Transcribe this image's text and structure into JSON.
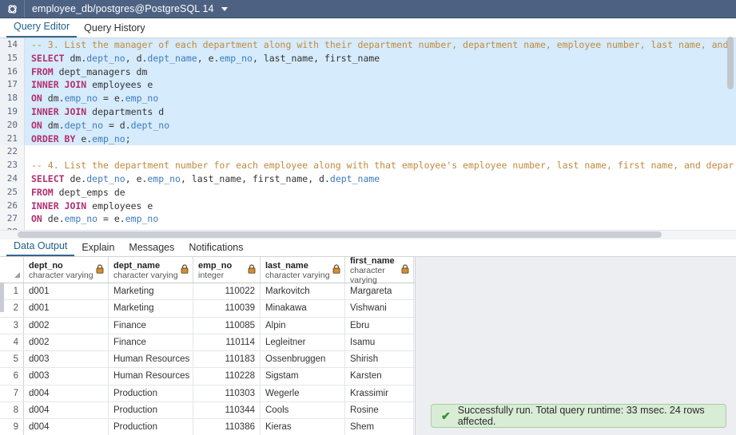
{
  "titlebar": {
    "connection": "employee_db/postgres@PostgreSQL 14",
    "icon": "query-tool-icon",
    "dropdown_icon": "chevron-down-icon"
  },
  "tabs": [
    {
      "label": "Query Editor",
      "active": true
    },
    {
      "label": "Query History",
      "active": false
    }
  ],
  "editor": {
    "lines": [
      {
        "no": "14",
        "selected": true,
        "tokens": [
          {
            "t": "cm",
            "v": "-- 3. List the manager of each department along with their department number, department name, employee number, last name, and"
          }
        ]
      },
      {
        "no": "15",
        "selected": true,
        "tokens": [
          {
            "t": "kw",
            "v": "SELECT"
          },
          {
            "t": "pl",
            "v": " dm."
          },
          {
            "t": "id",
            "v": "dept_no"
          },
          {
            "t": "pl",
            "v": ", d."
          },
          {
            "t": "id",
            "v": "dept_name"
          },
          {
            "t": "pl",
            "v": ", e."
          },
          {
            "t": "id",
            "v": "emp_no"
          },
          {
            "t": "pl",
            "v": ", last_name, first_name"
          }
        ]
      },
      {
        "no": "16",
        "selected": true,
        "tokens": [
          {
            "t": "kw",
            "v": "FROM"
          },
          {
            "t": "pl",
            "v": " dept_managers dm"
          }
        ]
      },
      {
        "no": "17",
        "selected": true,
        "tokens": [
          {
            "t": "kw",
            "v": "INNER JOIN"
          },
          {
            "t": "pl",
            "v": " employees e"
          }
        ]
      },
      {
        "no": "18",
        "selected": true,
        "tokens": [
          {
            "t": "kw",
            "v": "ON"
          },
          {
            "t": "pl",
            "v": " dm."
          },
          {
            "t": "id",
            "v": "emp_no"
          },
          {
            "t": "pl",
            "v": " = e."
          },
          {
            "t": "id",
            "v": "emp_no"
          }
        ]
      },
      {
        "no": "19",
        "selected": true,
        "tokens": [
          {
            "t": "kw",
            "v": "INNER JOIN"
          },
          {
            "t": "pl",
            "v": " departments d"
          }
        ]
      },
      {
        "no": "20",
        "selected": true,
        "tokens": [
          {
            "t": "kw",
            "v": "ON"
          },
          {
            "t": "pl",
            "v": " dm."
          },
          {
            "t": "id",
            "v": "dept_no"
          },
          {
            "t": "pl",
            "v": " = d."
          },
          {
            "t": "id",
            "v": "dept_no"
          }
        ]
      },
      {
        "no": "21",
        "selected": true,
        "tokens": [
          {
            "t": "kw",
            "v": "ORDER BY"
          },
          {
            "t": "pl",
            "v": " e."
          },
          {
            "t": "id",
            "v": "emp_no"
          },
          {
            "t": "pl",
            "v": ";"
          }
        ]
      },
      {
        "no": "22",
        "selected": false,
        "tokens": [
          {
            "t": "pl",
            "v": ""
          }
        ]
      },
      {
        "no": "23",
        "selected": false,
        "tokens": [
          {
            "t": "cm",
            "v": "-- 4. List the department number for each employee along with that employee's employee number, last name, first name, and depar"
          }
        ]
      },
      {
        "no": "24",
        "selected": false,
        "tokens": [
          {
            "t": "kw",
            "v": "SELECT"
          },
          {
            "t": "pl",
            "v": " de."
          },
          {
            "t": "id",
            "v": "dept_no"
          },
          {
            "t": "pl",
            "v": ", e."
          },
          {
            "t": "id",
            "v": "emp_no"
          },
          {
            "t": "pl",
            "v": ", last_name, first_name, d."
          },
          {
            "t": "id",
            "v": "dept_name"
          }
        ]
      },
      {
        "no": "25",
        "selected": false,
        "tokens": [
          {
            "t": "kw",
            "v": "FROM"
          },
          {
            "t": "pl",
            "v": " dept_emps de"
          }
        ]
      },
      {
        "no": "26",
        "selected": false,
        "tokens": [
          {
            "t": "kw",
            "v": "INNER JOIN"
          },
          {
            "t": "pl",
            "v": " employees e"
          }
        ]
      },
      {
        "no": "27",
        "selected": false,
        "tokens": [
          {
            "t": "kw",
            "v": "ON"
          },
          {
            "t": "pl",
            "v": " de."
          },
          {
            "t": "id",
            "v": "emp_no"
          },
          {
            "t": "pl",
            "v": " = e."
          },
          {
            "t": "id",
            "v": "emp_no"
          }
        ]
      },
      {
        "no": "28",
        "selected": false,
        "tokens": [
          {
            "t": "pl",
            "v": ""
          }
        ]
      }
    ]
  },
  "output": {
    "tabs": [
      {
        "label": "Data Output",
        "active": true
      },
      {
        "label": "Explain",
        "active": false
      },
      {
        "label": "Messages",
        "active": false
      },
      {
        "label": "Notifications",
        "active": false
      }
    ],
    "columns": [
      {
        "name": "dept_no",
        "type": "character varying",
        "lock": "lock-icon"
      },
      {
        "name": "dept_name",
        "type": "character varying",
        "lock": "lock-icon"
      },
      {
        "name": "emp_no",
        "type": "integer",
        "lock": "lock-icon"
      },
      {
        "name": "last_name",
        "type": "character varying",
        "lock": "lock-icon"
      },
      {
        "name": "first_name",
        "type": "character varying",
        "lock": "lock-icon"
      }
    ],
    "rows": [
      {
        "n": "1",
        "dept_no": "d001",
        "dept_name": "Marketing",
        "emp_no": "110022",
        "last_name": "Markovitch",
        "first_name": "Margareta"
      },
      {
        "n": "2",
        "dept_no": "d001",
        "dept_name": "Marketing",
        "emp_no": "110039",
        "last_name": "Minakawa",
        "first_name": "Vishwani"
      },
      {
        "n": "3",
        "dept_no": "d002",
        "dept_name": "Finance",
        "emp_no": "110085",
        "last_name": "Alpin",
        "first_name": "Ebru"
      },
      {
        "n": "4",
        "dept_no": "d002",
        "dept_name": "Finance",
        "emp_no": "110114",
        "last_name": "Legleitner",
        "first_name": "Isamu"
      },
      {
        "n": "5",
        "dept_no": "d003",
        "dept_name": "Human Resources",
        "emp_no": "110183",
        "last_name": "Ossenbruggen",
        "first_name": "Shirish"
      },
      {
        "n": "6",
        "dept_no": "d003",
        "dept_name": "Human Resources",
        "emp_no": "110228",
        "last_name": "Sigstam",
        "first_name": "Karsten"
      },
      {
        "n": "7",
        "dept_no": "d004",
        "dept_name": "Production",
        "emp_no": "110303",
        "last_name": "Wegerle",
        "first_name": "Krassimir"
      },
      {
        "n": "8",
        "dept_no": "d004",
        "dept_name": "Production",
        "emp_no": "110344",
        "last_name": "Cools",
        "first_name": "Rosine"
      },
      {
        "n": "9",
        "dept_no": "d004",
        "dept_name": "Production",
        "emp_no": "110386",
        "last_name": "Kieras",
        "first_name": "Shem"
      }
    ]
  },
  "toast": {
    "icon": "checkmark-icon",
    "message": "Successfully run. Total query runtime: 33 msec. 24 rows affected."
  },
  "colors": {
    "titlebar_bg": "#4d6282",
    "accent": "#326690",
    "selection_bg": "#d6ebfb",
    "toast_bg": "#d9ecd5",
    "toast_border": "#a7cf9f",
    "toast_check": "#3a8a3a",
    "keyword": "#b22e6f",
    "comment": "#c08a3e",
    "identifier": "#3e7bbf"
  }
}
